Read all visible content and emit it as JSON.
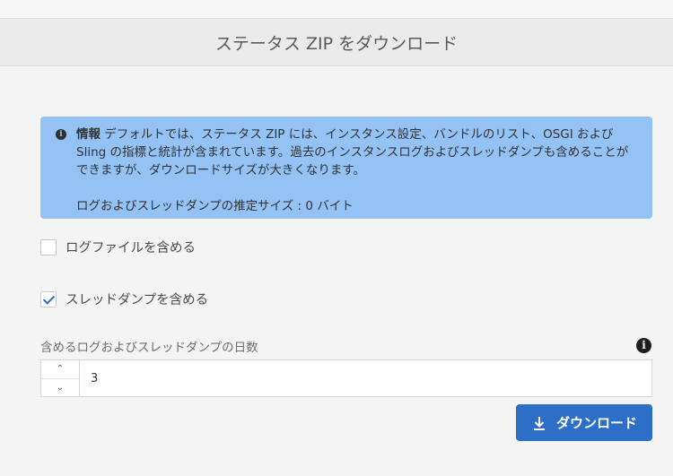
{
  "header": {
    "title": "ステータス ZIP をダウンロード"
  },
  "info": {
    "icon": "info-circle-icon",
    "label": "情報",
    "text": " デフォルトでは、ステータス ZIP には、インスタンス設定、バンドルのリスト、OSGI および Sling の指標と統計が含まれています。過去のインスタンスログおよびスレッドダンプも含めることができますが、ダウンロードサイズが大きくなります。",
    "size_text": "ログおよびスレッドダンプの推定サイズ : 0 バイト"
  },
  "options": {
    "include_logs": {
      "label": "ログファイルを含める",
      "checked": false
    },
    "include_thread_dumps": {
      "label": "スレッドダンプを含める",
      "checked": true
    }
  },
  "days": {
    "label": "含めるログおよびスレッドダンプの日数",
    "value": "3",
    "up": "^",
    "down": "v"
  },
  "download": {
    "label": "ダウンロード",
    "color": "#2d6fc6"
  }
}
